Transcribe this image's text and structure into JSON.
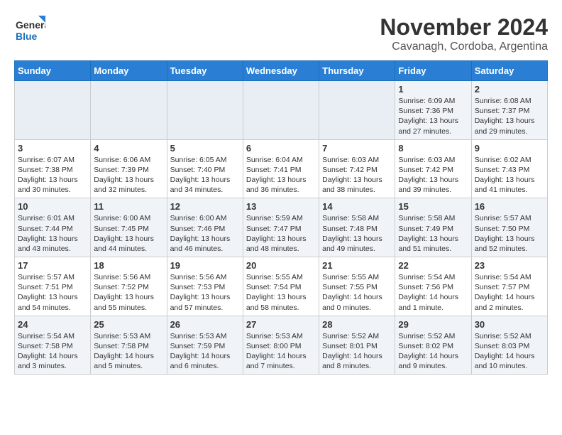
{
  "header": {
    "logo_line1": "General",
    "logo_line2": "Blue",
    "month": "November 2024",
    "location": "Cavanagh, Cordoba, Argentina"
  },
  "days_of_week": [
    "Sunday",
    "Monday",
    "Tuesday",
    "Wednesday",
    "Thursday",
    "Friday",
    "Saturday"
  ],
  "weeks": [
    {
      "days": [
        {
          "num": "",
          "info": ""
        },
        {
          "num": "",
          "info": ""
        },
        {
          "num": "",
          "info": ""
        },
        {
          "num": "",
          "info": ""
        },
        {
          "num": "",
          "info": ""
        },
        {
          "num": "1",
          "info": "Sunrise: 6:09 AM\nSunset: 7:36 PM\nDaylight: 13 hours\nand 27 minutes."
        },
        {
          "num": "2",
          "info": "Sunrise: 6:08 AM\nSunset: 7:37 PM\nDaylight: 13 hours\nand 29 minutes."
        }
      ]
    },
    {
      "days": [
        {
          "num": "3",
          "info": "Sunrise: 6:07 AM\nSunset: 7:38 PM\nDaylight: 13 hours\nand 30 minutes."
        },
        {
          "num": "4",
          "info": "Sunrise: 6:06 AM\nSunset: 7:39 PM\nDaylight: 13 hours\nand 32 minutes."
        },
        {
          "num": "5",
          "info": "Sunrise: 6:05 AM\nSunset: 7:40 PM\nDaylight: 13 hours\nand 34 minutes."
        },
        {
          "num": "6",
          "info": "Sunrise: 6:04 AM\nSunset: 7:41 PM\nDaylight: 13 hours\nand 36 minutes."
        },
        {
          "num": "7",
          "info": "Sunrise: 6:03 AM\nSunset: 7:42 PM\nDaylight: 13 hours\nand 38 minutes."
        },
        {
          "num": "8",
          "info": "Sunrise: 6:03 AM\nSunset: 7:42 PM\nDaylight: 13 hours\nand 39 minutes."
        },
        {
          "num": "9",
          "info": "Sunrise: 6:02 AM\nSunset: 7:43 PM\nDaylight: 13 hours\nand 41 minutes."
        }
      ]
    },
    {
      "days": [
        {
          "num": "10",
          "info": "Sunrise: 6:01 AM\nSunset: 7:44 PM\nDaylight: 13 hours\nand 43 minutes."
        },
        {
          "num": "11",
          "info": "Sunrise: 6:00 AM\nSunset: 7:45 PM\nDaylight: 13 hours\nand 44 minutes."
        },
        {
          "num": "12",
          "info": "Sunrise: 6:00 AM\nSunset: 7:46 PM\nDaylight: 13 hours\nand 46 minutes."
        },
        {
          "num": "13",
          "info": "Sunrise: 5:59 AM\nSunset: 7:47 PM\nDaylight: 13 hours\nand 48 minutes."
        },
        {
          "num": "14",
          "info": "Sunrise: 5:58 AM\nSunset: 7:48 PM\nDaylight: 13 hours\nand 49 minutes."
        },
        {
          "num": "15",
          "info": "Sunrise: 5:58 AM\nSunset: 7:49 PM\nDaylight: 13 hours\nand 51 minutes."
        },
        {
          "num": "16",
          "info": "Sunrise: 5:57 AM\nSunset: 7:50 PM\nDaylight: 13 hours\nand 52 minutes."
        }
      ]
    },
    {
      "days": [
        {
          "num": "17",
          "info": "Sunrise: 5:57 AM\nSunset: 7:51 PM\nDaylight: 13 hours\nand 54 minutes."
        },
        {
          "num": "18",
          "info": "Sunrise: 5:56 AM\nSunset: 7:52 PM\nDaylight: 13 hours\nand 55 minutes."
        },
        {
          "num": "19",
          "info": "Sunrise: 5:56 AM\nSunset: 7:53 PM\nDaylight: 13 hours\nand 57 minutes."
        },
        {
          "num": "20",
          "info": "Sunrise: 5:55 AM\nSunset: 7:54 PM\nDaylight: 13 hours\nand 58 minutes."
        },
        {
          "num": "21",
          "info": "Sunrise: 5:55 AM\nSunset: 7:55 PM\nDaylight: 14 hours\nand 0 minutes."
        },
        {
          "num": "22",
          "info": "Sunrise: 5:54 AM\nSunset: 7:56 PM\nDaylight: 14 hours\nand 1 minute."
        },
        {
          "num": "23",
          "info": "Sunrise: 5:54 AM\nSunset: 7:57 PM\nDaylight: 14 hours\nand 2 minutes."
        }
      ]
    },
    {
      "days": [
        {
          "num": "24",
          "info": "Sunrise: 5:54 AM\nSunset: 7:58 PM\nDaylight: 14 hours\nand 3 minutes."
        },
        {
          "num": "25",
          "info": "Sunrise: 5:53 AM\nSunset: 7:58 PM\nDaylight: 14 hours\nand 5 minutes."
        },
        {
          "num": "26",
          "info": "Sunrise: 5:53 AM\nSunset: 7:59 PM\nDaylight: 14 hours\nand 6 minutes."
        },
        {
          "num": "27",
          "info": "Sunrise: 5:53 AM\nSunset: 8:00 PM\nDaylight: 14 hours\nand 7 minutes."
        },
        {
          "num": "28",
          "info": "Sunrise: 5:52 AM\nSunset: 8:01 PM\nDaylight: 14 hours\nand 8 minutes."
        },
        {
          "num": "29",
          "info": "Sunrise: 5:52 AM\nSunset: 8:02 PM\nDaylight: 14 hours\nand 9 minutes."
        },
        {
          "num": "30",
          "info": "Sunrise: 5:52 AM\nSunset: 8:03 PM\nDaylight: 14 hours\nand 10 minutes."
        }
      ]
    }
  ]
}
